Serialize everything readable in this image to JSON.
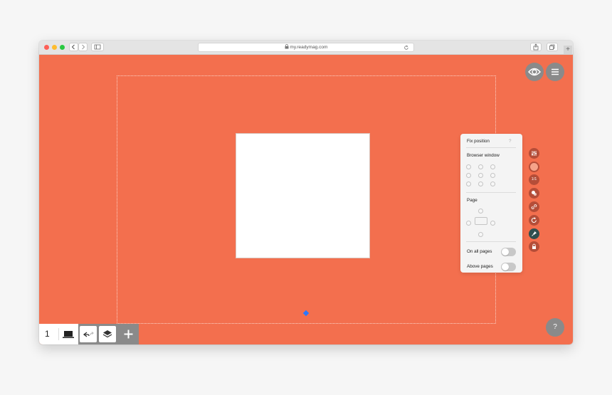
{
  "browser": {
    "url": "my.readymag.com",
    "traffic_lights": [
      "#fd5f57",
      "#febc2e",
      "#28c840"
    ],
    "back_icon": "chevron-left-icon",
    "forward_icon": "chevron-right-icon",
    "sidebar_icon": "sidebar-icon",
    "lock_icon": "lock-icon",
    "reload_icon": "reload-icon",
    "share_icon": "share-icon",
    "tabs_icon": "tabs-icon",
    "new_tab_icon": "plus-icon"
  },
  "canvas": {
    "background": "#f36f4e"
  },
  "top_right": {
    "preview_icon": "eye-icon",
    "menu_icon": "hamburger-icon"
  },
  "fix_panel": {
    "title": "Fix position",
    "help": "?",
    "browser_window_label": "Browser window",
    "page_label": "Page",
    "on_all_pages_label": "On all pages",
    "on_all_pages": false,
    "above_pages_label": "Above pages",
    "above_pages": false
  },
  "toolbar": {
    "items": [
      "settings-sliders-icon",
      "fill-color-icon",
      "ratio-icon",
      "effects-icon",
      "link-icon",
      "rotate-icon",
      "pin-icon",
      "lock-icon"
    ],
    "ratio_label": "1/1",
    "fill_color": "#f6a389",
    "active_color": "#2f4f4f"
  },
  "bottom_bar": {
    "page_number": "1",
    "device_icon": "laptop-icon",
    "undo_icon": "undo-icon",
    "redo_icon": "redo-icon",
    "layers_icon": "layers-icon",
    "add_icon": "plus-icon"
  },
  "help_button": "?"
}
